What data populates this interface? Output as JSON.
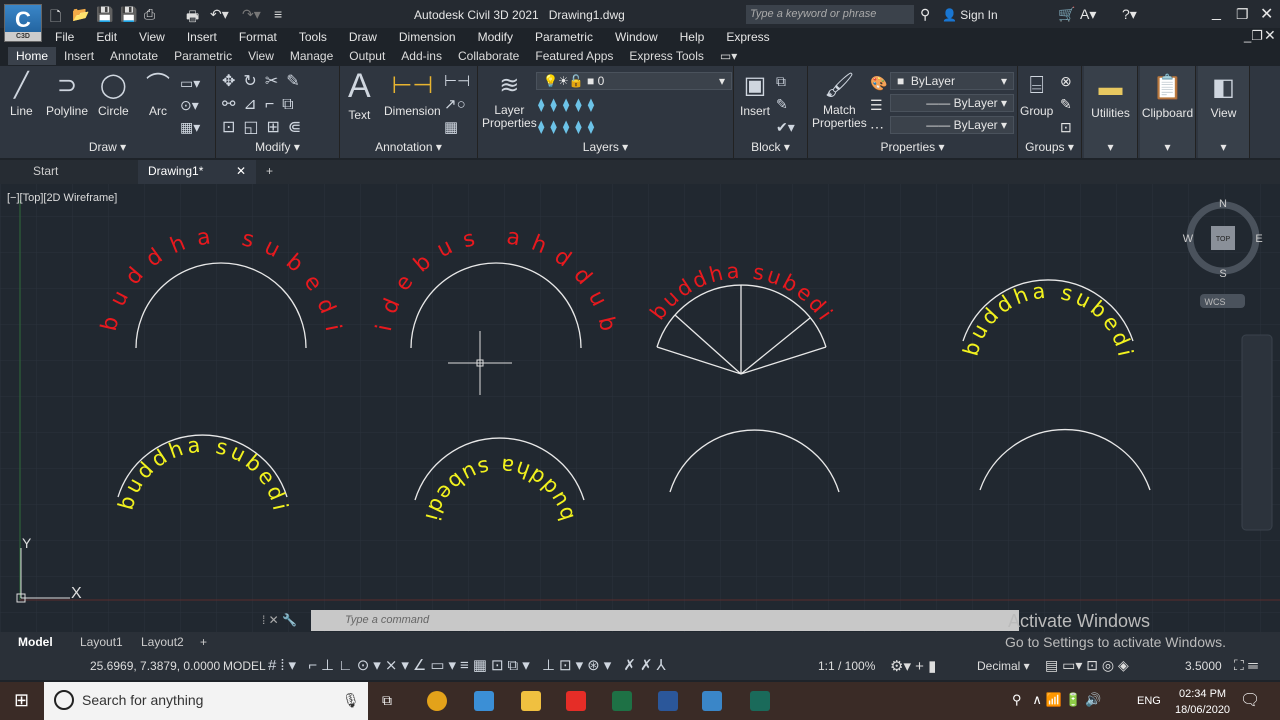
{
  "app": {
    "title": "Autodesk Civil 3D 2021",
    "document": "Drawing1.dwg",
    "logo_text": "C",
    "logo_sub": "C3D"
  },
  "search": {
    "placeholder": "Type a keyword or phrase"
  },
  "account": {
    "sign_in": "Sign In"
  },
  "menubar": [
    "File",
    "Edit",
    "View",
    "Insert",
    "Format",
    "Tools",
    "Draw",
    "Dimension",
    "Modify",
    "Parametric",
    "Window",
    "Help",
    "Express"
  ],
  "ribbon_tabs": [
    "Home",
    "Insert",
    "Annotate",
    "Parametric",
    "View",
    "Manage",
    "Output",
    "Add-ins",
    "Collaborate",
    "Featured Apps",
    "Express Tools"
  ],
  "ribbon": {
    "draw": {
      "title": "Draw",
      "line": "Line",
      "polyline": "Polyline",
      "circle": "Circle",
      "arc": "Arc"
    },
    "modify": {
      "title": "Modify"
    },
    "annotation": {
      "title": "Annotation",
      "text": "Text",
      "dimension": "Dimension"
    },
    "layers": {
      "title": "Layers",
      "layer_properties": "Layer\nProperties",
      "current_layer": "0"
    },
    "block": {
      "title": "Block",
      "insert": "Insert"
    },
    "properties": {
      "title": "Properties",
      "match": "Match\nProperties",
      "color": "ByLayer",
      "linetype": "ByLayer",
      "lineweight": "ByLayer"
    },
    "groups": {
      "title": "Groups",
      "group": "Group"
    },
    "utilities": "Utilities",
    "clipboard": "Clipboard",
    "view": "View"
  },
  "file_tabs": {
    "start": "Start",
    "drawing": "Drawing1*"
  },
  "viewport": {
    "label": "[−][Top][2D Wireframe]",
    "viewcube": {
      "n": "N",
      "s": "S",
      "e": "E",
      "w": "W",
      "top": "TOP",
      "wcs": "WCS"
    },
    "ucs_y": "Y",
    "ucs_x": "X"
  },
  "drawing": {
    "text_normal": "buddha subedi",
    "text_reversed": "idebus ahddub",
    "colors": {
      "red": "#e8191e",
      "yellow": "#f2f21e",
      "arc": "#e8e8e8"
    }
  },
  "command": {
    "placeholder": "Type a command"
  },
  "layout_tabs": [
    "Model",
    "Layout1",
    "Layout2"
  ],
  "status": {
    "coords": "25.6969, 7.3879, 0.0000",
    "model": "MODEL",
    "scale": "1:1 / 100%",
    "units": "Decimal",
    "value": "3.5000"
  },
  "watermark": {
    "line1": "Activate Windows",
    "line2": "Go to Settings to activate Windows."
  },
  "taskbar": {
    "search": "Search for anything",
    "lang": "ENG",
    "time": "02:34 PM",
    "date": "18/06/2020"
  }
}
